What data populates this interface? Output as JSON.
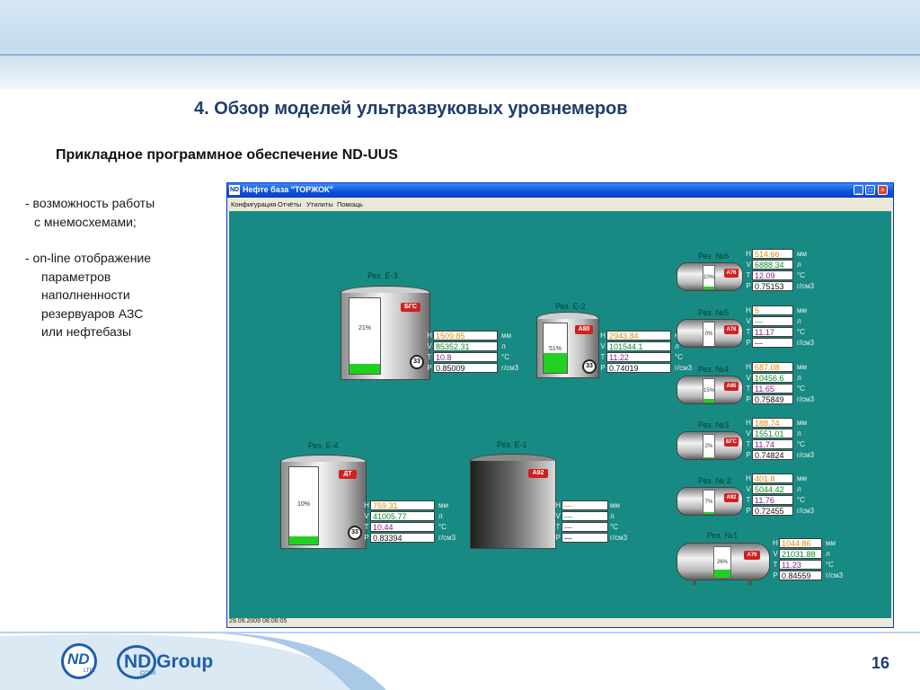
{
  "slide": {
    "title": "4.  Обзор моделей ультразвуковых уровнемеров",
    "subtitle": "Прикладное программное обеспечение ND-UUS",
    "bullets": {
      "b1_line1": "- возможность работы",
      "b1_line2": "с мнемосхемами;",
      "b2_line1": "- on-line отображение",
      "b2_line2": "параметров",
      "b2_line3": "наполненности",
      "b2_line4": "резервуаров АЗС",
      "b2_line5": "или нефтебазы"
    },
    "page_number": "16",
    "logos": {
      "nd_ltd": "ND",
      "nd_ltd_sub": "LTD.",
      "nd_group": "ND Group",
      "nd_corp": "CORP."
    }
  },
  "app": {
    "logo": "ND",
    "title": "Нефте база \"ТОРЖОК\"",
    "win_buttons": {
      "min": "_",
      "max": "□",
      "close": "×"
    },
    "menu": [
      "Конфигурация",
      "Отчёты",
      "Утилиты",
      "Помощь"
    ],
    "status": "29.09.2009 08:06:05",
    "param_labels": {
      "h": "H",
      "v": "V",
      "t": "T",
      "p": "P"
    },
    "units": {
      "h": "мм",
      "v": "л",
      "t": "°С",
      "p": "г/см3"
    },
    "meter_label": "33",
    "tanks": [
      {
        "label": "Рез. Е-3",
        "fuel": "БГС",
        "fill": 0.13,
        "pct": "21%",
        "h": "1509.85",
        "v": "85352.31",
        "t": "10.8",
        "p": "0.85009"
      },
      {
        "label": "Рез. Е-2",
        "fuel": "А80",
        "fill": 0.4,
        "pct": "51%",
        "h": "2943.84",
        "v": "101544.1",
        "t": "11.22",
        "p": "0.74019"
      },
      {
        "label": "Рез. Е-4",
        "fuel": "ДТ",
        "fill": 0.1,
        "pct": "10%",
        "h": "759.31",
        "v": "41005.77",
        "t": "10.44",
        "p": "0.83394"
      },
      {
        "label": "Рез. Е-1",
        "fuel": "А92",
        "fill": 0,
        "pct": "",
        "h": "---",
        "v": "---",
        "t": "---",
        "p": "---"
      },
      {
        "label": "Рез. №6",
        "fuel": "А76",
        "fill": 0.1,
        "pct": "10%",
        "h": "514.66",
        "v": "6888.34",
        "t": "12.09",
        "p": "0.75153"
      },
      {
        "label": "Рез. №5",
        "fuel": "А76",
        "fill": 0,
        "pct": "0%",
        "h": "5",
        "v": "---",
        "t": "11.17",
        "p": "---"
      },
      {
        "label": "Рез. №4",
        "fuel": "А95",
        "fill": 0.15,
        "pct": "15%",
        "h": "687.08",
        "v": "10456.6",
        "t": "11.65",
        "p": "0.75849"
      },
      {
        "label": "Рез. №3",
        "fuel": "БГС",
        "fill": 0.02,
        "pct": "2%",
        "h": "188.74",
        "v": "1551.01",
        "t": "11.74",
        "p": "0.74824"
      },
      {
        "label": "Рез. № 2",
        "fuel": "А92",
        "fill": 0.07,
        "pct": "7%",
        "h": "401.8",
        "v": "5044.42",
        "t": "11.76",
        "p": "0.72455"
      },
      {
        "label": "Рез. №1",
        "fuel": "А76",
        "fill": 0.26,
        "pct": "26%",
        "h": "1044.86",
        "v": "21031.88",
        "t": "11.23",
        "p": "0.84559"
      }
    ]
  }
}
